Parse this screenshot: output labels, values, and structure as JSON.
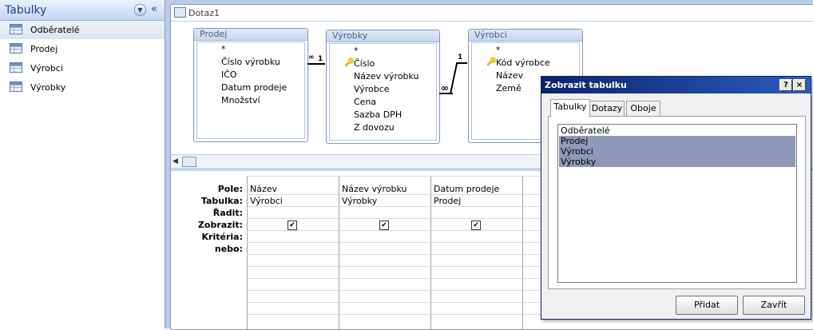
{
  "nav": {
    "title": "Tabulky",
    "items": [
      {
        "label": "Odběratelé",
        "icon": "table-icon"
      },
      {
        "label": "Prodej",
        "icon": "table-icon"
      },
      {
        "label": "Výrobci",
        "icon": "table-icon"
      },
      {
        "label": "Výrobky",
        "icon": "table-icon"
      }
    ]
  },
  "document": {
    "title": "Dotaz1",
    "tables": [
      {
        "name": "Prodej",
        "fields": [
          "*",
          "Číslo výrobku",
          "IČO",
          "Datum prodeje",
          "Množství"
        ]
      },
      {
        "name": "Výrobky",
        "fields": [
          "*",
          "Číslo",
          "Název výrobku",
          "Výrobce",
          "Cena",
          "Sazba DPH",
          "Z dovozu"
        ]
      },
      {
        "name": "Výrobci",
        "fields": [
          "*",
          "Kód výrobce",
          "Název",
          "Země"
        ]
      }
    ],
    "relation_one": "1",
    "relation_many": "∞"
  },
  "grid": {
    "row_labels": [
      "Pole:",
      "Tabulka:",
      "Řadit:",
      "Zobrazit:",
      "Kritéria:",
      "nebo:"
    ],
    "columns": [
      {
        "field": "Název",
        "table": "Výrobci",
        "show": true
      },
      {
        "field": "Název výrobku",
        "table": "Výrobky",
        "show": true
      },
      {
        "field": "Datum prodeje",
        "table": "Prodej",
        "show": true
      }
    ]
  },
  "dialog": {
    "title": "Zobrazit tabulku",
    "help_btn": "?",
    "close_btn": "×",
    "tabs": [
      "Tabulky",
      "Dotazy",
      "Oboje"
    ],
    "active_tab": "Tabulky",
    "list": [
      "Odběratelé",
      "Prodej",
      "Výrobci",
      "Výrobky"
    ],
    "selected": [
      "Prodej",
      "Výrobci",
      "Výrobky"
    ],
    "add_btn": "Přidat",
    "close_label": "Zavřít"
  },
  "colors": {
    "title_bar": "#0a246a",
    "selection": "#8e9ab9",
    "nav_header": "#c5d8f1"
  }
}
